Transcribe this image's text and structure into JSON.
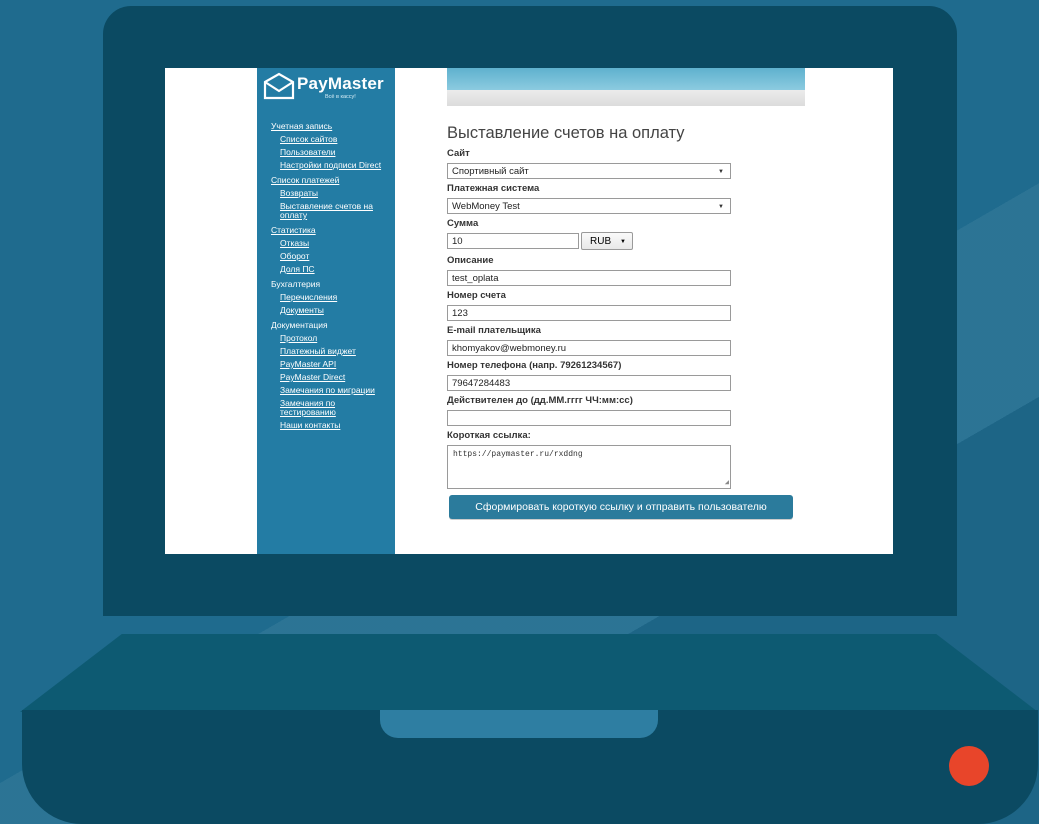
{
  "logo": {
    "name": "PayMaster",
    "tagline": "Всё в кассу!"
  },
  "sidebar": {
    "sections": [
      {
        "label": "Учетная запись",
        "underline": true,
        "items": [
          "Список сайтов",
          "Пользователи",
          "Настройки подписи Direct"
        ]
      },
      {
        "label": "Список платежей",
        "underline": true,
        "items": [
          "Возвраты",
          "Выставление счетов на оплату"
        ]
      },
      {
        "label": "Статистика",
        "underline": true,
        "items": [
          "Отказы",
          "Оборот",
          "Доля ПС"
        ]
      },
      {
        "label": "Бухгалтерия",
        "underline": false,
        "items": [
          "Перечисления",
          "Документы"
        ]
      },
      {
        "label": "Документация",
        "underline": false,
        "items": [
          "Протокол",
          "Платежный виджет",
          "PayMaster API",
          "PayMaster Direct",
          "Замечания по миграции",
          "Замечания по тестированию",
          "Наши контакты"
        ]
      }
    ]
  },
  "main": {
    "title": "Выставление счетов на оплату",
    "site": {
      "label": "Сайт",
      "value": "Спортивный сайт"
    },
    "payment_system": {
      "label": "Платежная система",
      "value": "WebMoney Test"
    },
    "amount": {
      "label": "Сумма",
      "value": "10",
      "currency": "RUB"
    },
    "description": {
      "label": "Описание",
      "value": "test_oplata"
    },
    "invoice_number": {
      "label": "Номер счета",
      "value": "123"
    },
    "payer_email": {
      "label": "E-mail плательщика",
      "value": "khomyakov@webmoney.ru"
    },
    "phone": {
      "label": "Номер телефона (напр. 79261234567)",
      "value": "79647284483"
    },
    "valid_until": {
      "label": "Действителен до (дд.ММ.гггг ЧЧ:мм:сс)",
      "value": ""
    },
    "short_link": {
      "label": "Короткая ссылка:",
      "value": "https://paymaster.ru/rxddng"
    },
    "submit_label": "Сформировать короткую ссылку и отправить пользователю"
  },
  "colors": {
    "background": "#1f6b8e",
    "laptop_body": "#0b4a62",
    "sidebar": "#237ca4",
    "button": "#2b7b9c",
    "power_dot": "#e8452a"
  }
}
